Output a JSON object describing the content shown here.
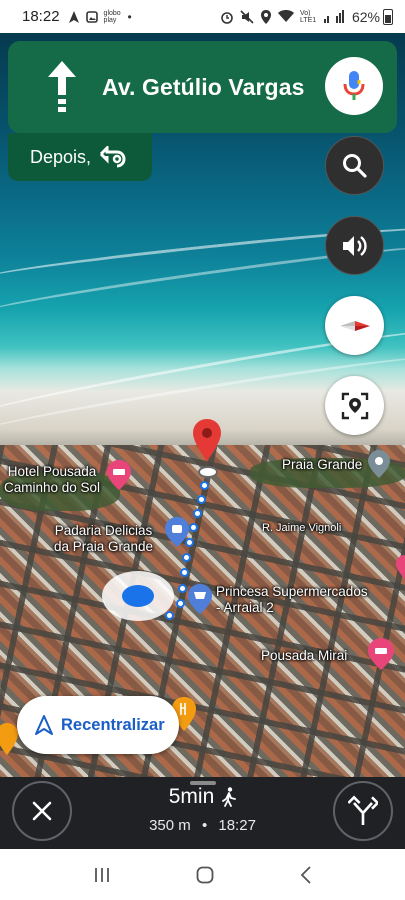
{
  "status_bar": {
    "time": "18:22",
    "carrier_tag": "globo play",
    "network": "Vo) LTE1",
    "battery": "62%"
  },
  "navigation": {
    "direction_icon": "arrow-up-icon",
    "street": "Av. Getúlio Vargas",
    "then_label": "Depois,",
    "then_icon": "u-turn-left-icon",
    "banner_color": "#156b47"
  },
  "side_buttons": [
    "search-icon",
    "volume-icon",
    "compass-icon",
    "report-icon"
  ],
  "map": {
    "labels": {
      "hotel": "Hotel Pousada\nCaminho do Sol",
      "praia": "Praia Grande",
      "padaria": "Padaria Delicias\nda Praia Grande",
      "street": "R. Jaime Vignoli",
      "super": "Princesa Supermercados\n- Arraial 2",
      "pousada": "Pousada Mirai"
    }
  },
  "recenter": {
    "label": "Recentralizar"
  },
  "trip": {
    "duration": "5min",
    "mode_icon": "walking-icon",
    "distance": "350 m",
    "separator": "•",
    "arrival": "18:27"
  },
  "colors": {
    "route": "#1a73e8",
    "accent_text": "#1a5fc8",
    "bottom_sheet": "#202124"
  }
}
